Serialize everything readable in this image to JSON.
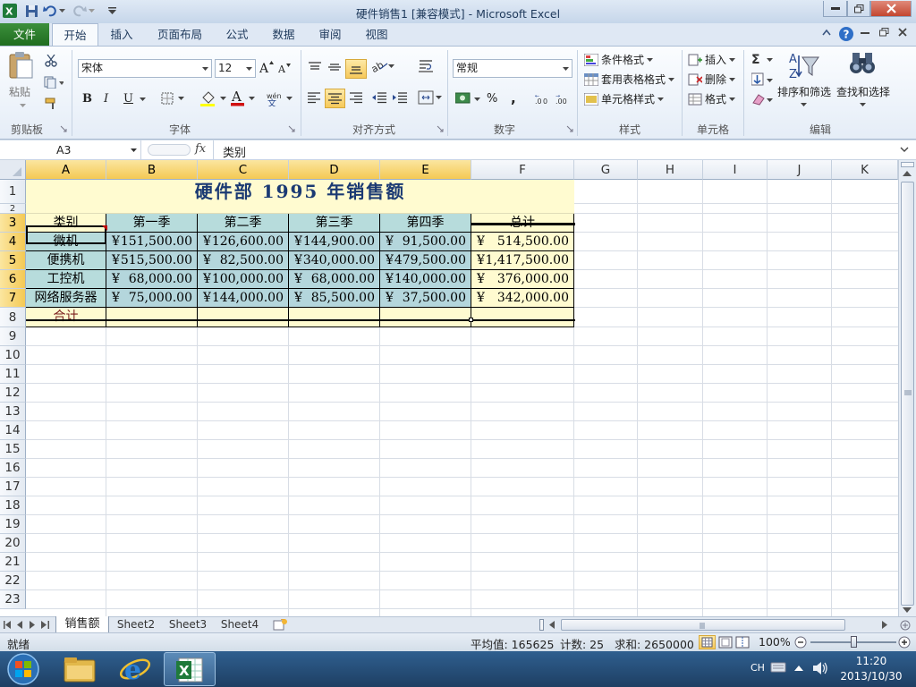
{
  "window": {
    "title": "硬件销售1  [兼容模式] - Microsoft Excel"
  },
  "ribbon_tabs": [
    "文件",
    "开始",
    "插入",
    "页面布局",
    "公式",
    "数据",
    "审阅",
    "视图"
  ],
  "ribbon": {
    "clipboard": {
      "label": "剪贴板",
      "paste": "粘贴"
    },
    "font": {
      "label": "字体",
      "font_name": "宋体",
      "font_size": "12"
    },
    "alignment": {
      "label": "对齐方式"
    },
    "number": {
      "label": "数字",
      "format": "常规"
    },
    "styles": {
      "label": "样式",
      "conditional": "条件格式",
      "table": "套用表格格式",
      "cell_style": "单元格样式"
    },
    "cells": {
      "label": "单元格",
      "insert": "插入",
      "delete": "删除",
      "format": "格式"
    },
    "editing": {
      "label": "编辑",
      "sort": "排序和筛选",
      "find": "查找和选择"
    }
  },
  "formula_bar": {
    "name_box": "A3",
    "fx": "fx",
    "content": "类别"
  },
  "columns": [
    "A",
    "B",
    "C",
    "D",
    "E",
    "F",
    "G",
    "H",
    "I",
    "J",
    "K"
  ],
  "rows": [
    "1",
    "2",
    "3",
    "4",
    "5",
    "6",
    "7",
    "8",
    "9",
    "10",
    "11",
    "12",
    "13",
    "14",
    "15",
    "16",
    "17",
    "18",
    "19",
    "20",
    "21",
    "22",
    "23"
  ],
  "sheet": {
    "title": "硬件部 1995 年销售额",
    "headers": [
      "类别",
      "第一季",
      "第二季",
      "第三季",
      "第四季",
      "总计"
    ],
    "currency": "¥",
    "data": [
      [
        "微机",
        "151,500.00",
        "126,600.00",
        "144,900.00",
        "91,500.00",
        "514,500.00"
      ],
      [
        "便携机",
        "515,500.00",
        "82,500.00",
        "340,000.00",
        "479,500.00",
        "1,417,500.00"
      ],
      [
        "工控机",
        "68,000.00",
        "100,000.00",
        "68,000.00",
        "140,000.00",
        "376,000.00"
      ],
      [
        "网络服务器",
        "75,000.00",
        "144,000.00",
        "85,500.00",
        "37,500.00",
        "342,000.00"
      ]
    ],
    "total_label": "合计"
  },
  "sheet_tabs": [
    "销售额",
    "Sheet2",
    "Sheet3",
    "Sheet4"
  ],
  "status": {
    "ready": "就绪",
    "average": "平均值: 165625",
    "count": "计数: 25",
    "sum": "求和: 2650000",
    "zoom": "100%"
  },
  "taskbar": {
    "lang": "CH",
    "time": "11:20",
    "date": "2013/10/30"
  },
  "colors": {
    "title_fill": "#fffbd0",
    "header_fill": "#b7dcdc",
    "number_fill": "#b4d6dc",
    "total_fill": "#fffbd0",
    "green_file_tab": "#2a7d2a"
  }
}
